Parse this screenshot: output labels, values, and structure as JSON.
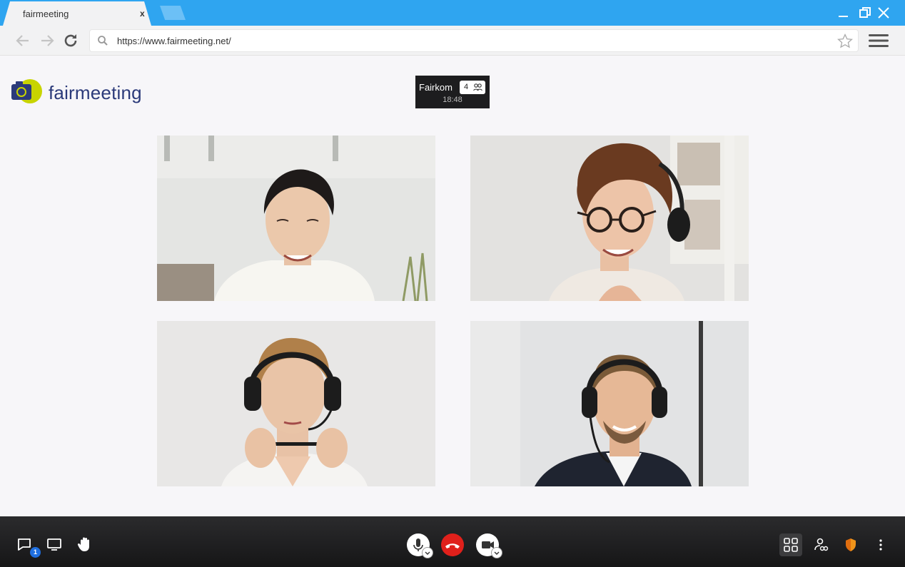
{
  "browser": {
    "tab_title": "fairmeeting",
    "tab_close": "x",
    "url": "https://www.fairmeeting.net/"
  },
  "logo": {
    "text": "fairmeeting"
  },
  "meeting": {
    "name": "Fairkom",
    "participant_count": "4",
    "time": "18:48"
  },
  "video_tiles": [
    {
      "participant": "woman with dark hair in white sweater"
    },
    {
      "participant": "woman with glasses and headset"
    },
    {
      "participant": "woman with headset holding pen"
    },
    {
      "participant": "man with headset in suit"
    }
  ],
  "controls": {
    "chat_badge": "1",
    "icons": [
      "chat-icon",
      "screen-share-icon",
      "raise-hand-icon",
      "microphone-icon",
      "hangup-icon",
      "camera-icon",
      "tile-view-icon",
      "participants-icon",
      "security-shield-icon",
      "more-options-icon"
    ],
    "colors": {
      "hangup": "#e0201b",
      "security": "#f0941a",
      "badge": "#1f6fe0",
      "titlebar": "#2fa5f0"
    }
  }
}
